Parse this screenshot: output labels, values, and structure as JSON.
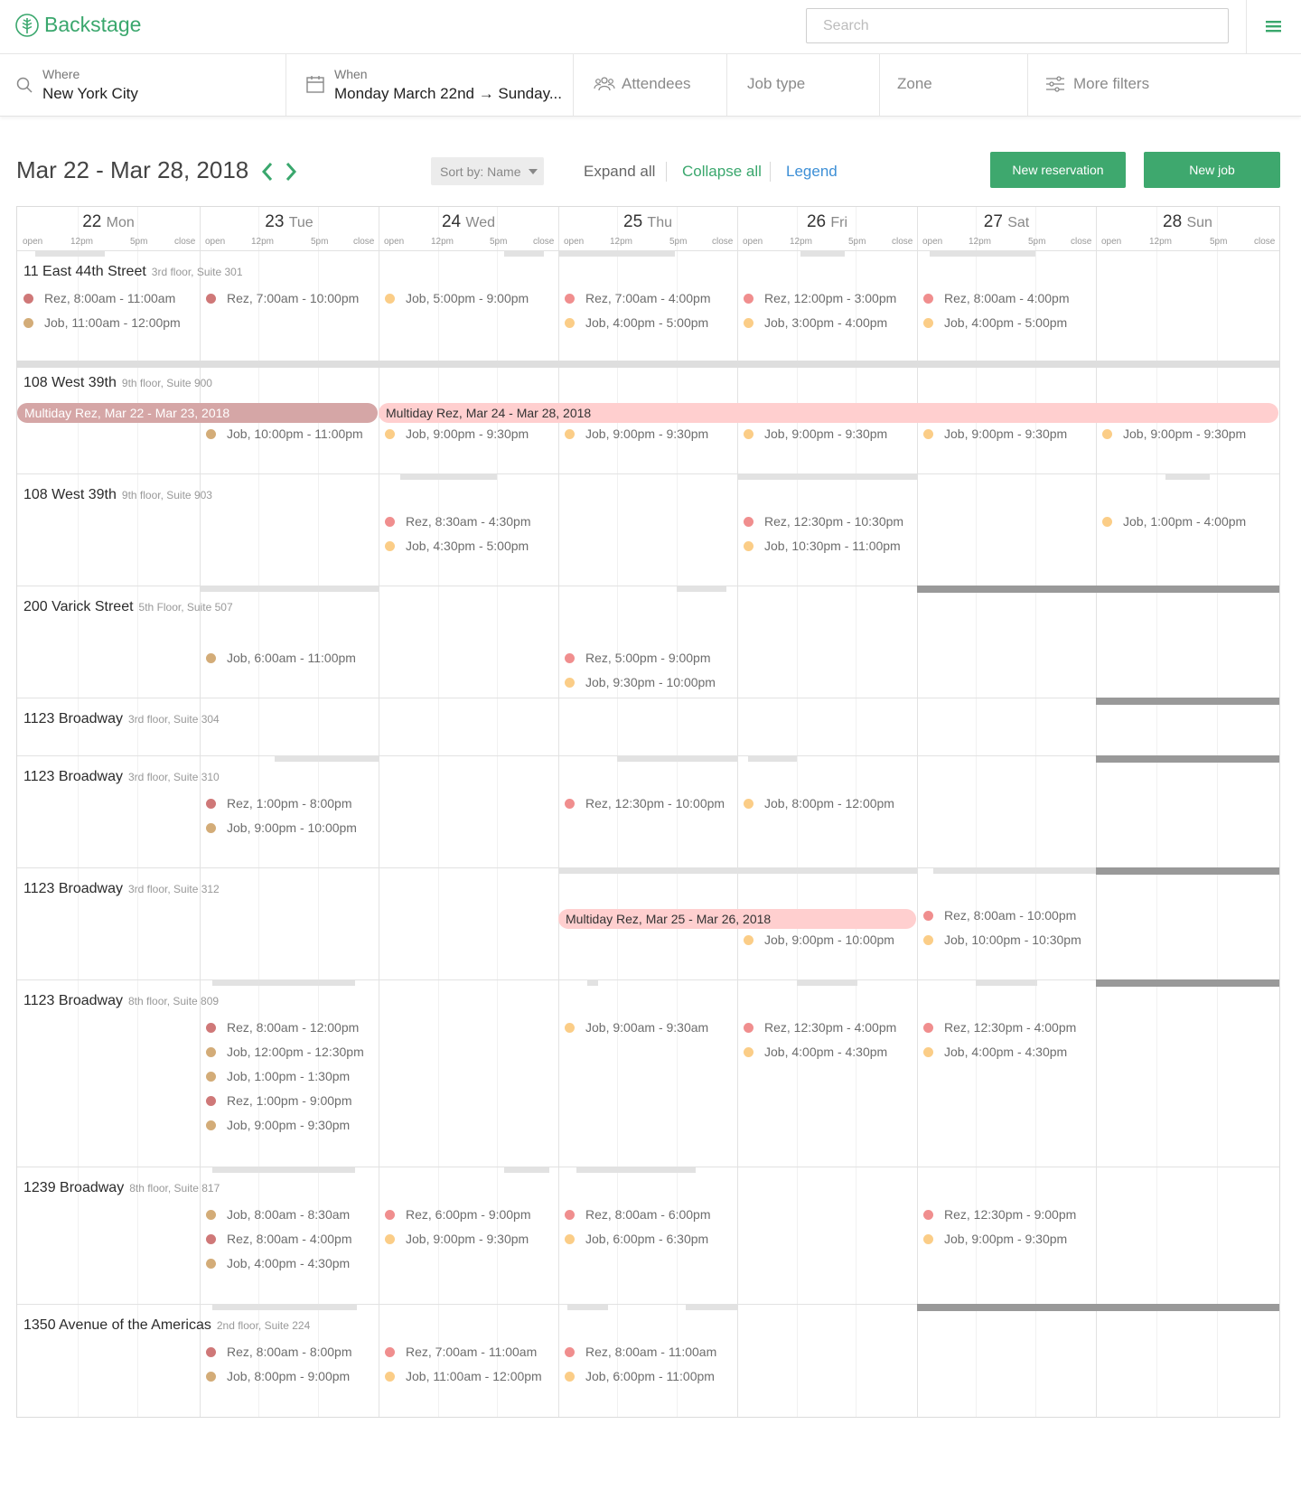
{
  "app": {
    "name": "Backstage"
  },
  "search": {
    "placeholder": "Search"
  },
  "filters": {
    "where_label": "Where",
    "where_value": "New York City",
    "when_label": "When",
    "when_value": "Monday March 22nd → Sunday...",
    "attendees": "Attendees",
    "job_type": "Job type",
    "zone": "Zone",
    "more_filters": "More filters"
  },
  "toolbar": {
    "range_title": "Mar 22 - Mar 28, 2018",
    "sort_label": "Sort by: Name",
    "expand_all": "Expand all",
    "collapse_all": "Collapse all",
    "legend": "Legend",
    "new_reservation": "New reservation",
    "new_job": "New job"
  },
  "colors": {
    "brand_green": "#3aa76d",
    "link_blue": "#3d8fd6",
    "rez_dark": "#cf7878",
    "job_dark": "#d3ac78",
    "rez_light": "#f08e8e",
    "job_light": "#fbcd87",
    "multiday_past": "#d5a6a6",
    "multiday_future": "#ffcfcf"
  },
  "tick_labels": {
    "open": "open",
    "noon": "12pm",
    "five": "5pm",
    "close": "close"
  },
  "days": [
    {
      "num": "22",
      "name": "Mon"
    },
    {
      "num": "23",
      "name": "Tue"
    },
    {
      "num": "24",
      "name": "Wed"
    },
    {
      "num": "25",
      "name": "Thu"
    },
    {
      "num": "26",
      "name": "Fri"
    },
    {
      "num": "27",
      "name": "Sat"
    },
    {
      "num": "28",
      "name": "Sun"
    }
  ],
  "rows": [
    {
      "address": "11 East 44th Street",
      "suite": "3rd floor, Suite 301",
      "avail": [
        [
          0,
          0.1,
          0.35
        ],
        [
          0,
          0.27,
          0.48
        ],
        [
          2,
          0.7,
          0.92
        ],
        [
          3,
          0,
          0.65
        ],
        [
          4,
          0.35,
          0.6
        ],
        [
          5,
          0.07,
          0.66
        ]
      ],
      "events": [
        {
          "day": 0,
          "slot": 0,
          "kind": "rez",
          "text": "Rez, 8:00am - 11:00am"
        },
        {
          "day": 0,
          "slot": 1,
          "kind": "job",
          "text": "Job, 11:00am - 12:00pm"
        },
        {
          "day": 1,
          "slot": 0,
          "kind": "rez",
          "text": "Rez, 7:00am - 10:00pm"
        },
        {
          "day": 2,
          "slot": 0,
          "kind": "job",
          "text": "Job, 5:00pm - 9:00pm"
        },
        {
          "day": 3,
          "slot": 0,
          "kind": "rez",
          "text": "Rez, 7:00am - 4:00pm"
        },
        {
          "day": 3,
          "slot": 1,
          "kind": "job",
          "text": "Job, 4:00pm - 5:00pm"
        },
        {
          "day": 4,
          "slot": 0,
          "kind": "rez",
          "text": "Rez, 12:00pm - 3:00pm"
        },
        {
          "day": 4,
          "slot": 1,
          "kind": "job",
          "text": "Job, 3:00pm - 4:00pm"
        },
        {
          "day": 5,
          "slot": 0,
          "kind": "rez",
          "text": "Rez, 8:00am - 4:00pm"
        },
        {
          "day": 5,
          "slot": 1,
          "kind": "job",
          "text": "Job, 4:00pm - 5:00pm"
        }
      ]
    },
    {
      "address": "108 West 39th",
      "suite": "9th floor, Suite 900",
      "multiday": [
        {
          "from": 0,
          "to": 2,
          "past": true,
          "text": "Multiday Rez, Mar 22 - Mar 23, 2018"
        },
        {
          "from": 2,
          "to": 7,
          "past": false,
          "text": "Multiday Rez, Mar 24 - Mar 28, 2018"
        }
      ],
      "events": [
        {
          "day": 1,
          "slot": 1,
          "kind": "job",
          "text": "Job, 10:00pm - 11:00pm"
        },
        {
          "day": 2,
          "slot": 1,
          "kind": "job",
          "text": "Job, 9:00pm - 9:30pm"
        },
        {
          "day": 3,
          "slot": 1,
          "kind": "job",
          "text": "Job, 9:00pm - 9:30pm"
        },
        {
          "day": 4,
          "slot": 1,
          "kind": "job",
          "text": "Job, 9:00pm - 9:30pm"
        },
        {
          "day": 5,
          "slot": 1,
          "kind": "job",
          "text": "Job, 9:00pm - 9:30pm"
        },
        {
          "day": 6,
          "slot": 1,
          "kind": "job",
          "text": "Job, 9:00pm - 9:30pm"
        }
      ]
    },
    {
      "address": "108 West 39th",
      "suite": "9th floor, Suite 903",
      "avail": [
        [
          2,
          0.12,
          0.66
        ],
        [
          4,
          0,
          1
        ],
        [
          6,
          0.38,
          0.62
        ]
      ],
      "events": [
        {
          "day": 2,
          "slot": 0,
          "kind": "rez",
          "text": "Rez, 8:30am - 4:30pm"
        },
        {
          "day": 2,
          "slot": 1,
          "kind": "job",
          "text": "Job, 4:30pm - 5:00pm"
        },
        {
          "day": 4,
          "slot": 0,
          "kind": "rez",
          "text": "Rez, 12:30pm - 10:30pm"
        },
        {
          "day": 4,
          "slot": 1,
          "kind": "job",
          "text": "Job, 10:30pm - 11:00pm"
        },
        {
          "day": 6,
          "slot": 0,
          "kind": "job",
          "text": "Job, 1:00pm - 4:00pm"
        }
      ]
    },
    {
      "address": "200 Varick Street",
      "suite": "5th Floor, Suite 507",
      "avail": [
        [
          1,
          0,
          1
        ],
        [
          3,
          0.66,
          0.94
        ]
      ],
      "dark": [
        [
          5,
          0,
          2
        ]
      ],
      "events": [
        {
          "day": 1,
          "slot": 1,
          "kind": "job",
          "text": "Job, 6:00am - 11:00pm"
        },
        {
          "day": 3,
          "slot": 1,
          "kind": "rez",
          "text": "Rez, 5:00pm - 9:00pm"
        },
        {
          "day": 3,
          "slot": 2,
          "kind": "job",
          "text": "Job, 9:30pm - 10:00pm"
        }
      ]
    },
    {
      "address": "1123 Broadway",
      "suite": "3rd floor, Suite 304",
      "dark": [
        [
          6,
          0,
          1
        ]
      ],
      "events": []
    },
    {
      "address": "1123 Broadway",
      "suite": "3rd floor, Suite 310",
      "avail": [
        [
          1,
          0.42,
          1
        ],
        [
          3,
          0.33,
          1
        ],
        [
          4,
          0.06,
          0.33
        ]
      ],
      "dark": [
        [
          6,
          0,
          1
        ]
      ],
      "events": [
        {
          "day": 1,
          "slot": 0,
          "kind": "rez",
          "text": "Rez, 1:00pm - 8:00pm"
        },
        {
          "day": 1,
          "slot": 1,
          "kind": "job",
          "text": "Job, 9:00pm - 10:00pm"
        },
        {
          "day": 3,
          "slot": 0,
          "kind": "rez",
          "text": "Rez, 12:30pm - 10:00pm"
        },
        {
          "day": 4,
          "slot": 0,
          "kind": "job",
          "text": "Job, 8:00pm - 12:00pm"
        }
      ]
    },
    {
      "address": "1123 Broadway",
      "suite": "3rd floor, Suite 312",
      "avail": [
        [
          3,
          0,
          2
        ],
        [
          5,
          0.09,
          1
        ]
      ],
      "dark": [
        [
          6,
          0,
          1
        ]
      ],
      "multiday": [
        {
          "from": 3,
          "to": 5,
          "past": false,
          "text": "Multiday Rez, Mar 25 - Mar 26, 2018"
        }
      ],
      "events": [
        {
          "day": 5,
          "slot": 0,
          "kind": "rez",
          "text": "Rez, 8:00am - 10:00pm"
        },
        {
          "day": 4,
          "slot": 1,
          "kind": "job",
          "text": "Job, 9:00pm - 10:00pm"
        },
        {
          "day": 5,
          "slot": 1,
          "kind": "job",
          "text": "Job, 10:00pm - 10:30pm"
        }
      ]
    },
    {
      "address": "1123 Broadway",
      "suite": "8th floor, Suite 809",
      "avail": [
        [
          1,
          0.07,
          0.87
        ],
        [
          3,
          0.16,
          0.22
        ],
        [
          4,
          0.33,
          0.67
        ],
        [
          5,
          0.33,
          0.67
        ]
      ],
      "dark": [
        [
          6,
          0,
          1
        ]
      ],
      "events": [
        {
          "day": 1,
          "slot": 0,
          "kind": "rez",
          "text": "Rez, 8:00am - 12:00pm"
        },
        {
          "day": 1,
          "slot": 1,
          "kind": "job",
          "text": "Job, 12:00pm - 12:30pm"
        },
        {
          "day": 1,
          "slot": 2,
          "kind": "job",
          "text": "Job, 1:00pm - 1:30pm"
        },
        {
          "day": 1,
          "slot": 3,
          "kind": "rez",
          "text": "Rez, 1:00pm - 9:00pm"
        },
        {
          "day": 1,
          "slot": 4,
          "kind": "job",
          "text": "Job, 9:00pm - 9:30pm"
        },
        {
          "day": 3,
          "slot": 0,
          "kind": "job",
          "text": "Job, 9:00am - 9:30am"
        },
        {
          "day": 4,
          "slot": 0,
          "kind": "rez",
          "text": "Rez, 12:30pm - 4:00pm"
        },
        {
          "day": 4,
          "slot": 1,
          "kind": "job",
          "text": "Job, 4:00pm - 4:30pm"
        },
        {
          "day": 5,
          "slot": 0,
          "kind": "rez",
          "text": "Rez, 12:30pm - 4:00pm"
        },
        {
          "day": 5,
          "slot": 1,
          "kind": "job",
          "text": "Job, 4:00pm - 4:30pm"
        }
      ]
    },
    {
      "address": "1239 Broadway",
      "suite": "8th floor, Suite 817",
      "avail": [
        [
          1,
          0.07,
          0.87
        ],
        [
          2,
          0.7,
          0.95
        ],
        [
          3,
          0.1,
          0.77
        ]
      ],
      "events": [
        {
          "day": 1,
          "slot": 0,
          "kind": "job",
          "text": "Job, 8:00am - 8:30am"
        },
        {
          "day": 1,
          "slot": 1,
          "kind": "rez",
          "text": "Rez, 8:00am - 4:00pm"
        },
        {
          "day": 1,
          "slot": 2,
          "kind": "job",
          "text": "Job, 4:00pm - 4:30pm"
        },
        {
          "day": 2,
          "slot": 0,
          "kind": "rez",
          "text": "Rez, 6:00pm - 9:00pm"
        },
        {
          "day": 2,
          "slot": 1,
          "kind": "job",
          "text": "Job, 9:00pm - 9:30pm"
        },
        {
          "day": 3,
          "slot": 0,
          "kind": "rez",
          "text": "Rez, 8:00am - 6:00pm"
        },
        {
          "day": 3,
          "slot": 1,
          "kind": "job",
          "text": "Job, 6:00pm - 6:30pm"
        },
        {
          "day": 5,
          "slot": 0,
          "kind": "rez",
          "text": "Rez, 12:30pm - 9:00pm"
        },
        {
          "day": 5,
          "slot": 1,
          "kind": "job",
          "text": "Job, 9:00pm - 9:30pm"
        }
      ]
    },
    {
      "address": "1350 Avenue of the Americas",
      "suite": "2nd floor, Suite 224",
      "avail": [
        [
          1,
          0.07,
          0.88
        ],
        [
          3,
          0.05,
          0.28
        ],
        [
          3,
          0.71,
          1
        ]
      ],
      "dark": [
        [
          5,
          0,
          2
        ]
      ],
      "events": [
        {
          "day": 1,
          "slot": 0,
          "kind": "rez",
          "text": "Rez, 8:00am - 8:00pm"
        },
        {
          "day": 1,
          "slot": 1,
          "kind": "job",
          "text": "Job, 8:00pm - 9:00pm"
        },
        {
          "day": 2,
          "slot": 0,
          "kind": "rez",
          "text": "Rez, 7:00am - 11:00am"
        },
        {
          "day": 2,
          "slot": 1,
          "kind": "job",
          "text": "Job, 11:00am - 12:00pm"
        },
        {
          "day": 3,
          "slot": 0,
          "kind": "rez",
          "text": "Rez, 8:00am - 11:00am"
        },
        {
          "day": 3,
          "slot": 1,
          "kind": "job",
          "text": "Job, 6:00pm - 11:00pm"
        }
      ]
    }
  ]
}
